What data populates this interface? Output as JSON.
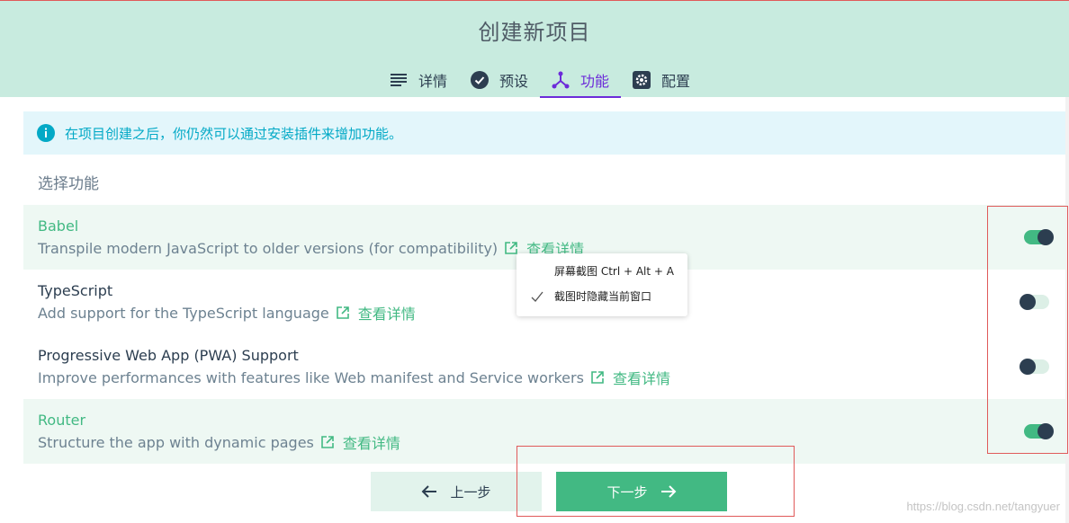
{
  "title": "创建新项目",
  "tabs": [
    {
      "label": "详情",
      "icon": "list-icon"
    },
    {
      "label": "预设",
      "icon": "check-circle-icon"
    },
    {
      "label": "功能",
      "icon": "features-icon",
      "active": true
    },
    {
      "label": "配置",
      "icon": "gear-icon"
    }
  ],
  "info": {
    "text": "在项目创建之后，你仍然可以通过安装插件来增加功能。"
  },
  "section_title": "选择功能",
  "features": [
    {
      "name": "Babel",
      "desc": "Transpile modern JavaScript to older versions (for compatibility)",
      "link": "查看详情",
      "enabled": true
    },
    {
      "name": "TypeScript",
      "desc": "Add support for the TypeScript language",
      "link": "查看详情",
      "enabled": false
    },
    {
      "name": "Progressive Web App (PWA) Support",
      "desc": "Improve performances with features like Web manifest and Service workers",
      "link": "查看详情",
      "enabled": false
    },
    {
      "name": "Router",
      "desc": "Structure the app with dynamic pages",
      "link": "查看详情",
      "enabled": true
    }
  ],
  "context_menu": {
    "items": [
      {
        "label": "屏幕截图 Ctrl + Alt + A",
        "checked": false
      },
      {
        "label": "截图时隐藏当前窗口",
        "checked": true
      }
    ]
  },
  "buttons": {
    "prev": "上一步",
    "next": "下一步"
  },
  "watermark": "https://blog.csdn.net/tangyuer",
  "colors": {
    "accent": "#42b983",
    "header_bg": "#c8ebdf",
    "active_tab": "#6c2bd9",
    "info": "#03a9c6"
  }
}
